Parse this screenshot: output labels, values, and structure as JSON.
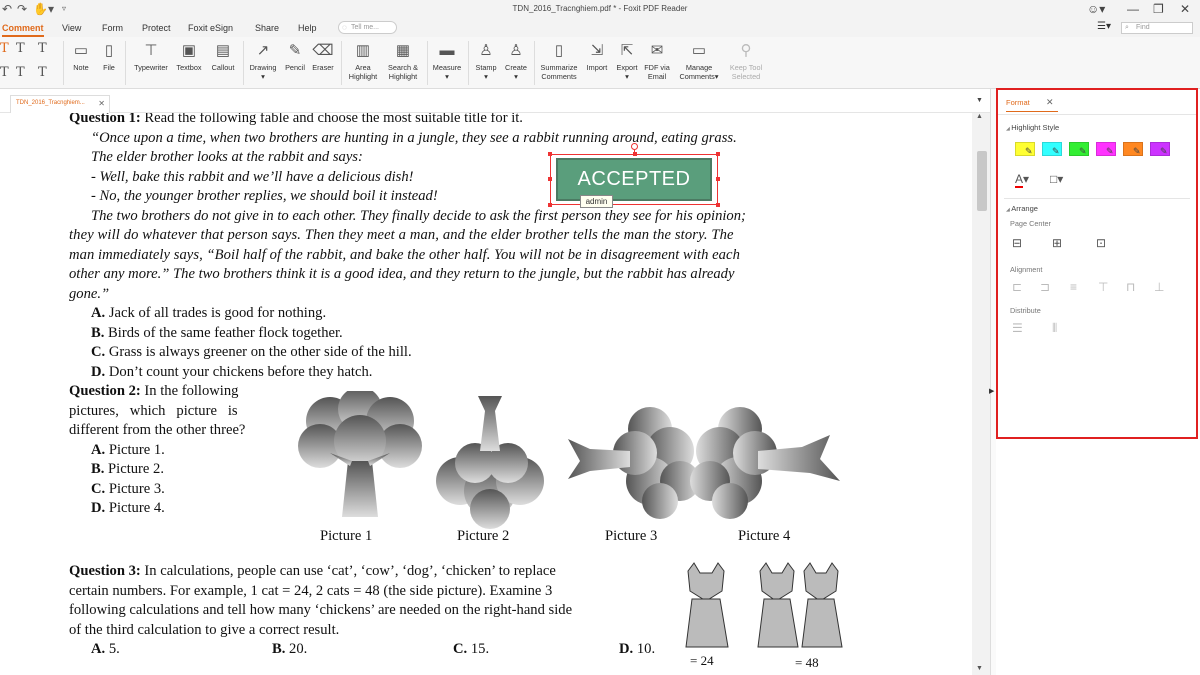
{
  "window": {
    "title": "TDN_2016_Tracnghiem.pdf * - Foxit PDF Reader"
  },
  "menu": {
    "items": [
      "Comment",
      "View",
      "Form",
      "Protect",
      "Foxit eSign",
      "Share",
      "Help"
    ],
    "tell_me": "Tell me...",
    "find": "Find"
  },
  "ribbon": {
    "note": "Note",
    "file": "File",
    "typewriter": "Typewriter",
    "textbox": "Textbox",
    "callout": "Callout",
    "drawing": "Drawing",
    "pencil": "Pencil",
    "eraser": "Eraser",
    "area_highlight": [
      "Area",
      "Highlight"
    ],
    "search_highlight": [
      "Search &",
      "Highlight"
    ],
    "measure": "Measure",
    "stamp": "Stamp",
    "create": "Create",
    "summarize": [
      "Summarize",
      "Comments"
    ],
    "import": "Import",
    "export": "Export",
    "fdf_email": [
      "FDF via",
      "Email"
    ],
    "manage": [
      "Manage",
      "Comments▾"
    ],
    "keep_tool": [
      "Keep Tool",
      "Selected"
    ]
  },
  "tab": {
    "doc_name": "TDN_2016_Tracnghiem..."
  },
  "panel": {
    "tab": "Format",
    "highlight_style": "Highlight Style",
    "highlight_colors": [
      "#ffff33",
      "#33ffff",
      "#33ee33",
      "#ff33ff",
      "#ff8822",
      "#cc33ff"
    ],
    "arrange": "Arrange",
    "page_center": "Page Center",
    "alignment": "Alignment",
    "distribute": "Distribute"
  },
  "stamp": {
    "text": "ACCEPTED",
    "author": "admin"
  },
  "doc": {
    "q1": {
      "label": "Question 1:",
      "prompt": "Read the following fable and choose the most suitable title for it.",
      "lines": [
        "“Once upon a time, when two brothers are hunting in a jungle, they see a rabbit running around, eating grass.",
        "The elder brother looks at the rabbit and says:",
        "- Well, bake this rabbit and we’ll have a delicious dish!",
        "- No, the younger brother replies, we should boil it instead!",
        "The two brothers do not give in to each other. They finally decide to ask the first person they see for his opinion;",
        "they will do whatever that person says. Then they meet a man, and the elder brother tells the man the story. The",
        "man immediately says, “Boil half of the rabbit, and bake the other half. You will not be in disagreement with each",
        "other any more.”  The two brothers think it is a good idea, and they return to the jungle, but the rabbit has already",
        "gone.”"
      ],
      "options": [
        {
          "l": "A.",
          "t": "Jack of all trades is good for nothing."
        },
        {
          "l": "B.",
          "t": "Birds of the same feather flock together."
        },
        {
          "l": "C.",
          "t": "Grass is always greener on the other side of the hill."
        },
        {
          "l": "D.",
          "t": "Don’t count your chickens before they hatch."
        }
      ]
    },
    "q2": {
      "label": "Question 2:",
      "lines": [
        "In the following",
        "pictures,   which   picture   is",
        "different from the other three?"
      ],
      "options": [
        {
          "l": "A.",
          "t": "Picture 1."
        },
        {
          "l": "B.",
          "t": "Picture 2."
        },
        {
          "l": "C.",
          "t": "Picture 3."
        },
        {
          "l": "D.",
          "t": "Picture 4."
        }
      ],
      "captions": [
        "Picture 1",
        "Picture 2",
        "Picture 3",
        "Picture 4"
      ]
    },
    "q3": {
      "label": "Question 3:",
      "lines": [
        "In calculations, people can use ‘cat’, ‘cow’, ‘dog’, ‘chicken’ to replace",
        "certain numbers. For example, 1 cat = 24, 2 cats = 48 (the side picture). Examine 3",
        "following calculations and tell how many ‘chickens’ are needed on the right-hand side",
        "of the third calculation to give a correct result."
      ],
      "options": [
        {
          "l": "A.",
          "t": "5."
        },
        {
          "l": "B.",
          "t": "20."
        },
        {
          "l": "C.",
          "t": "15."
        },
        {
          "l": "D.",
          "t": "10."
        }
      ],
      "eq1": "= 24",
      "eq2": "= 48"
    }
  }
}
